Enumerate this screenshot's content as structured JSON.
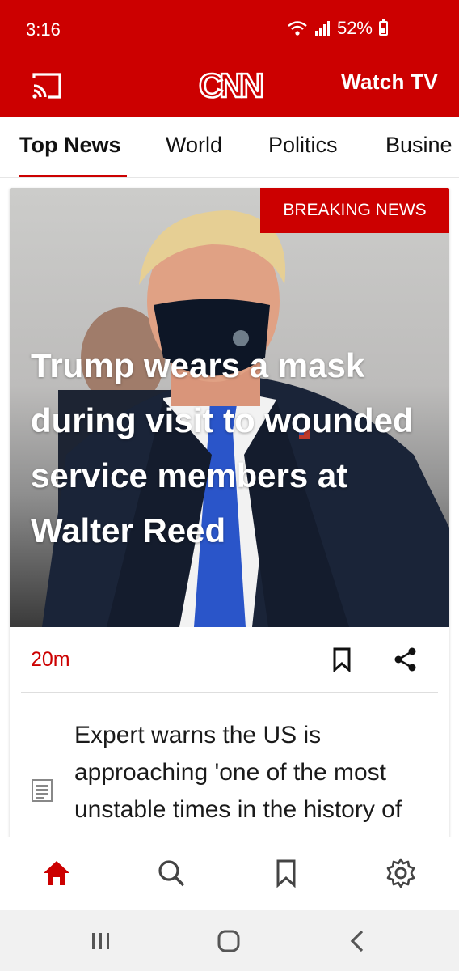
{
  "status_bar": {
    "time": "3:16",
    "battery": "52%"
  },
  "header": {
    "logo": "CNN",
    "watch_tv": "Watch TV"
  },
  "tabs": [
    {
      "label": "Top News",
      "active": true
    },
    {
      "label": "World",
      "active": false
    },
    {
      "label": "Politics",
      "active": false
    },
    {
      "label": "Busine",
      "active": false
    }
  ],
  "hero_story": {
    "badge": "BREAKING NEWS",
    "headline": "Trump wears a mask during visit to wounded service members at Walter Reed",
    "timestamp": "20m"
  },
  "next_story": {
    "title": "Expert warns the US is approaching 'one of the most unstable times in the history of our country'"
  },
  "bottom_nav": [
    "home-icon",
    "search-icon",
    "bookmark-icon",
    "settings-icon"
  ],
  "system_nav": [
    "recents-icon",
    "home-button-icon",
    "back-icon"
  ],
  "colors": {
    "brand_red": "#cc0000",
    "text": "#111111"
  }
}
